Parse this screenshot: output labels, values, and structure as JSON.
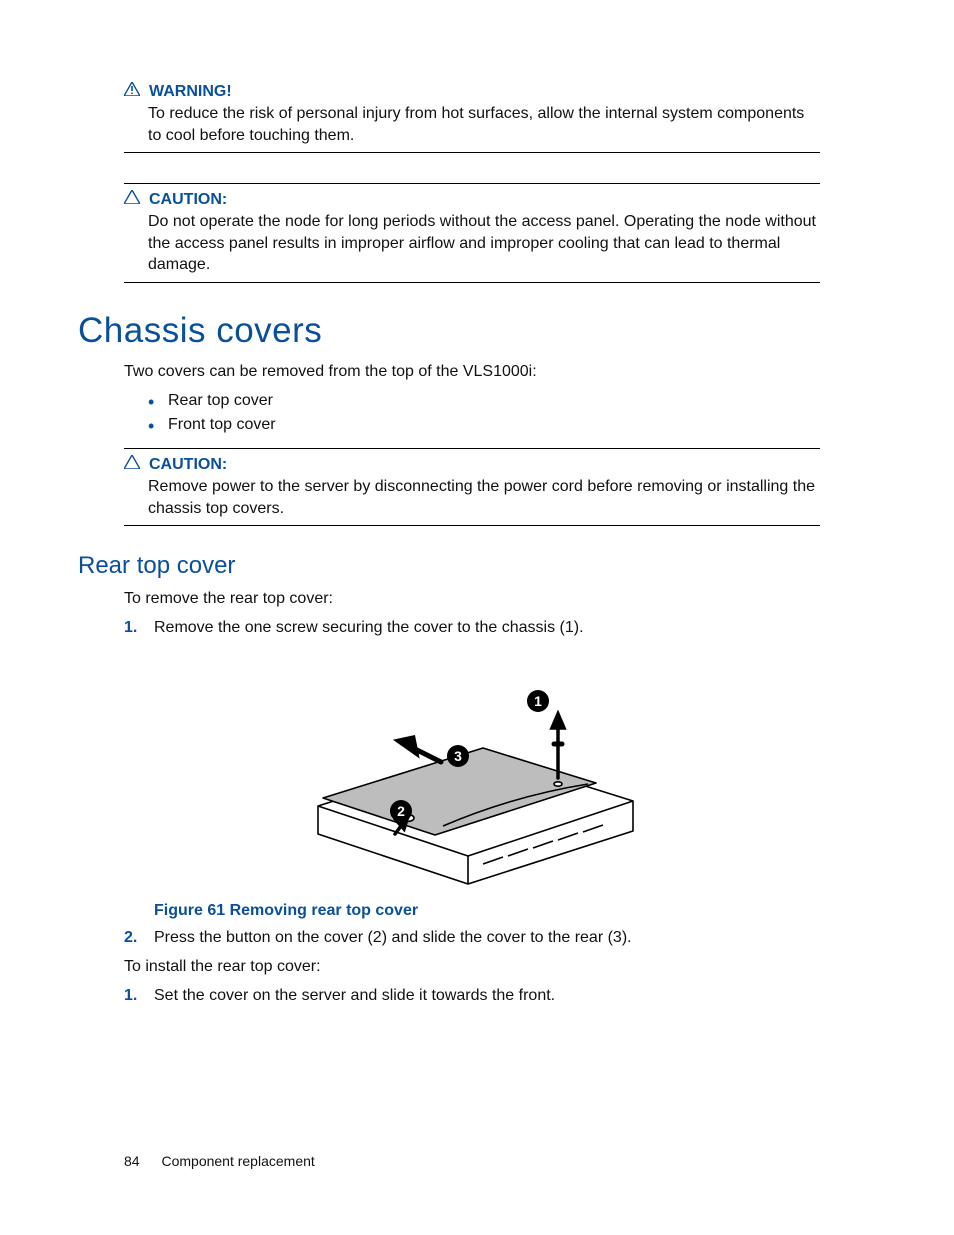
{
  "warning": {
    "label": "WARNING!",
    "text": "To reduce the risk of personal injury from hot surfaces, allow the internal system components to cool before touching them."
  },
  "caution1": {
    "label": "CAUTION:",
    "text": "Do not operate the node for long periods without the access panel. Operating the node without the access panel results in improper airflow and improper cooling that can lead to thermal damage."
  },
  "h1": "Chassis covers",
  "intro": "Two covers can be removed from the top of the VLS1000i:",
  "bullets": [
    "Rear top cover",
    "Front top cover"
  ],
  "caution2": {
    "label": "CAUTION:",
    "text": "Remove power to the server by disconnecting the power cord before removing or installing the chassis top covers."
  },
  "h2": "Rear top cover",
  "remove_lead": "To remove the rear top cover:",
  "remove_steps": [
    "Remove the one screw securing the cover to the chassis (1)."
  ],
  "figure": {
    "callouts": [
      "1",
      "2",
      "3"
    ],
    "caption": "Figure 61 Removing rear top cover"
  },
  "remove_after": [
    "Press the button on the cover (2) and slide the cover to the rear (3)."
  ],
  "install_lead": "To install the rear top cover:",
  "install_steps": [
    "Set the cover on the server and slide it towards the front."
  ],
  "footer": {
    "page": "84",
    "section": "Component replacement"
  }
}
